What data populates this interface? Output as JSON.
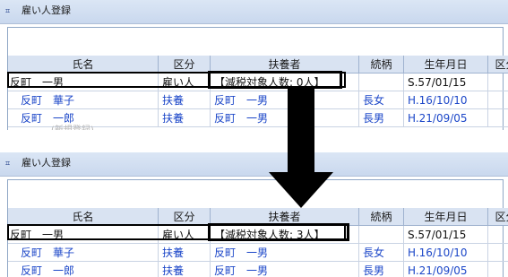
{
  "window": {
    "title": "雇い人登録",
    "icon": "app-window-icon"
  },
  "columns": {
    "name": "氏名",
    "kubun": "区分",
    "fuyosha": "扶養者",
    "zokugara": "続柄",
    "birthdate": "生年月日",
    "kubun2": "区分"
  },
  "ghost_text": "(新規登録)",
  "before": {
    "rows": [
      {
        "name": "反町　一男",
        "kubun": "雇い人",
        "fuyosha": "【減税対象人数: 0人】",
        "zokugara": "",
        "birthdate": "S.57/01/15"
      },
      {
        "name": "反町　華子",
        "kubun": "扶養",
        "fuyosha": "反町　一男",
        "zokugara": "長女",
        "birthdate": "H.16/10/10"
      },
      {
        "name": "反町　一郎",
        "kubun": "扶養",
        "fuyosha": "反町　一男",
        "zokugara": "長男",
        "birthdate": "H.21/09/05"
      }
    ]
  },
  "after": {
    "rows": [
      {
        "name": "反町　一男",
        "kubun": "雇い人",
        "fuyosha": "【減税対象人数: 3人】",
        "zokugara": "",
        "birthdate": "S.57/01/15"
      },
      {
        "name": "反町　華子",
        "kubun": "扶養",
        "fuyosha": "反町　一男",
        "zokugara": "長女",
        "birthdate": "H.16/10/10"
      },
      {
        "name": "反町　一郎",
        "kubun": "扶養",
        "fuyosha": "反町　一男",
        "zokugara": "長男",
        "birthdate": "H.21/09/05"
      }
    ]
  },
  "colors": {
    "dependent_text": "#1b46c8",
    "header_bg": "#d9e3f2",
    "highlight": "#000000"
  }
}
